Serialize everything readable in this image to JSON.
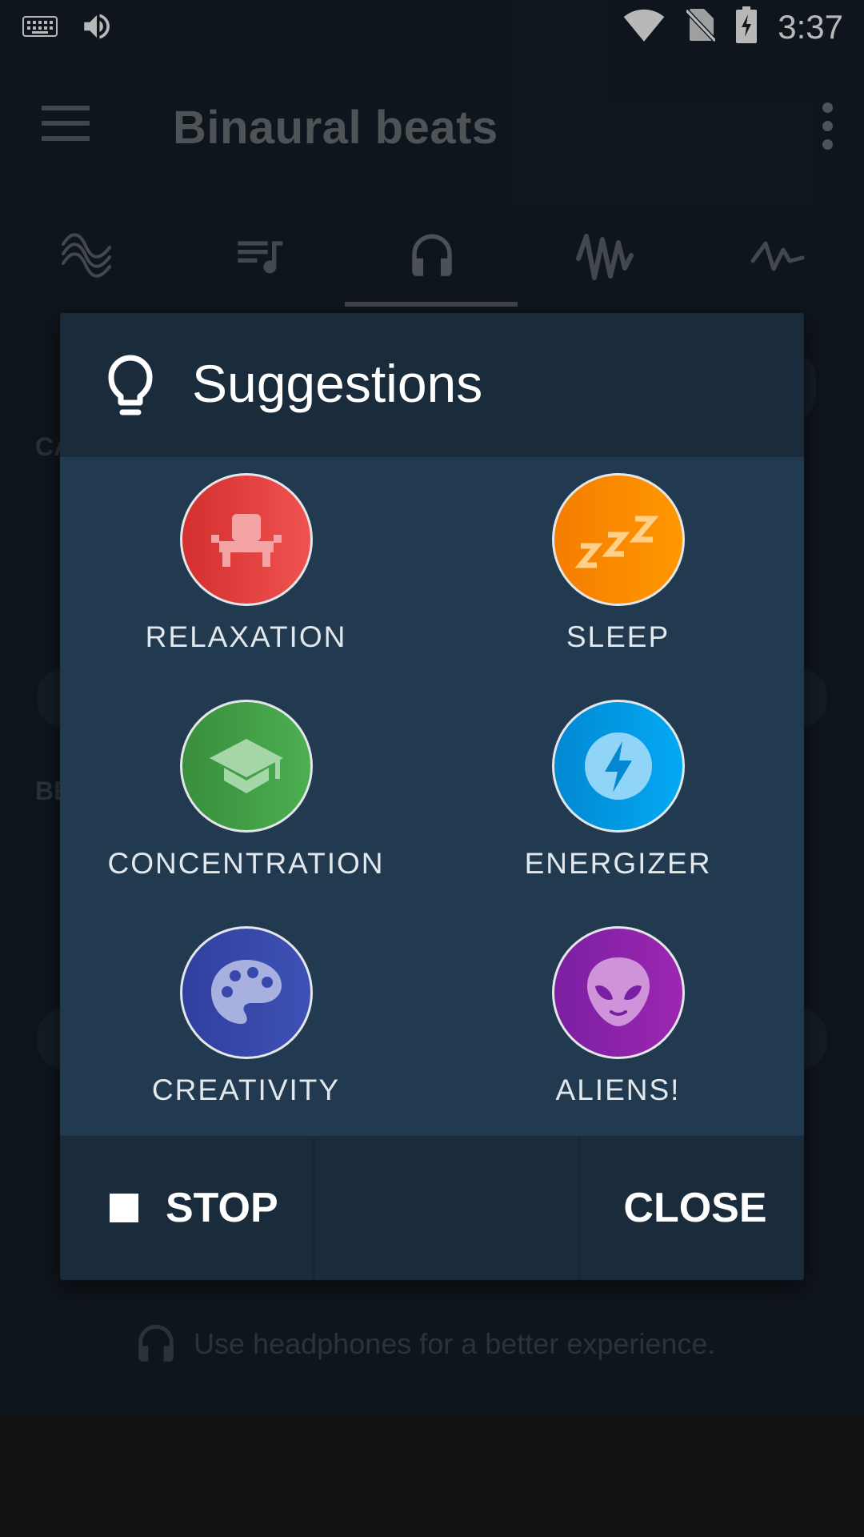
{
  "status_bar": {
    "time": "3:37",
    "icons": [
      "keyboard-icon",
      "volume-icon",
      "wifi-icon",
      "no-sim-icon",
      "battery-charging-icon"
    ]
  },
  "app_bar": {
    "title": "Binaural beats",
    "menu_icon": "hamburger-menu-icon",
    "overflow_icon": "overflow-menu-icon"
  },
  "tabs": [
    {
      "icon": "sine-wave-icon",
      "selected": false
    },
    {
      "icon": "playlist-music-icon",
      "selected": false
    },
    {
      "icon": "headphones-icon",
      "selected": true
    },
    {
      "icon": "waveform-icon",
      "selected": false
    },
    {
      "icon": "pulse-icon",
      "selected": false
    }
  ],
  "background": {
    "label_1": "CA",
    "label_2": "BE",
    "footer_hint": "Use headphones for a better experience."
  },
  "dialog": {
    "title": "Suggestions",
    "title_icon": "lightbulb-icon",
    "items": [
      {
        "label": "RELAXATION",
        "icon": "armchair-icon",
        "color": "#e53935"
      },
      {
        "label": "SLEEP",
        "icon": "zzz-icon",
        "color": "#fb8c00"
      },
      {
        "label": "CONCENTRATION",
        "icon": "graduation-cap-icon",
        "color": "#43a047"
      },
      {
        "label": "ENERGIZER",
        "icon": "lightning-bolt-icon",
        "color": "#039be5"
      },
      {
        "label": "CREATIVITY",
        "icon": "palette-icon",
        "color": "#3949ab"
      },
      {
        "label": "ALIENS!",
        "icon": "alien-icon",
        "color": "#8e24aa"
      }
    ],
    "stop_label": "STOP",
    "close_label": "CLOSE"
  }
}
